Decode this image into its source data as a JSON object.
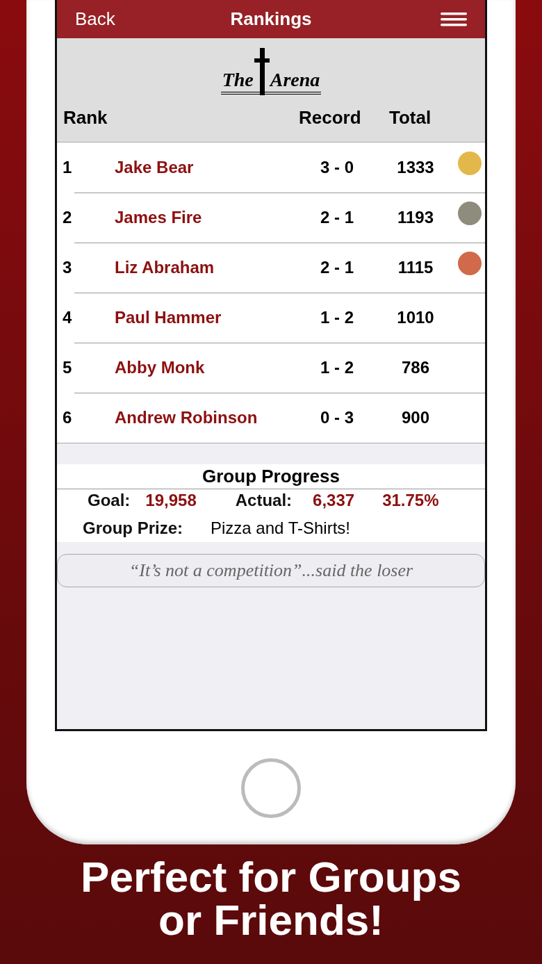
{
  "nav": {
    "back": "Back",
    "title": "Rankings"
  },
  "logo": {
    "left": "The",
    "right": "Arena"
  },
  "columns": {
    "rank": "Rank",
    "record": "Record",
    "total": "Total"
  },
  "rows": [
    {
      "rank": "1",
      "name": "Jake Bear",
      "record": "3 - 0",
      "total": "1333",
      "color": "#e3b84a"
    },
    {
      "rank": "2",
      "name": "James Fire",
      "record": "2 - 1",
      "total": "1193",
      "color": "#8e8c7d"
    },
    {
      "rank": "3",
      "name": "Liz Abraham",
      "record": "2 - 1",
      "total": "1115",
      "color": "#d06a4a"
    },
    {
      "rank": "4",
      "name": "Paul Hammer",
      "record": "1 - 2",
      "total": "1010"
    },
    {
      "rank": "5",
      "name": "Abby Monk",
      "record": "1 - 2",
      "total": "786"
    },
    {
      "rank": "6",
      "name": "Andrew Robinson",
      "record": "0 - 3",
      "total": "900"
    }
  ],
  "progress": {
    "title": "Group Progress",
    "goal_label": "Goal:",
    "goal": "19,958",
    "actual_label": "Actual:",
    "actual": "6,337",
    "percent": "31.75%",
    "prize_label": "Group Prize:",
    "prize": "Pizza and T-Shirts!"
  },
  "quote": "“It’s not a competition”...said the loser",
  "caption": "Perfect for Groups or Friends!"
}
